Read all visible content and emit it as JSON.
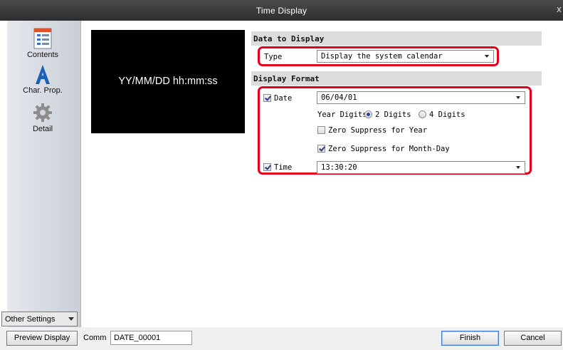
{
  "window": {
    "title": "Time Display",
    "close_glyph": "x"
  },
  "sidebar": {
    "items": [
      {
        "label": "Contents",
        "icon": "contents-icon"
      },
      {
        "label": "Char. Prop.",
        "icon": "char-prop-icon"
      },
      {
        "label": "Detail",
        "icon": "gear-icon"
      }
    ],
    "other_settings": "Other Settings"
  },
  "preview": {
    "text": "YY/MM/DD hh:mm:ss"
  },
  "data_to_display": {
    "header": "Data to Display",
    "type_label": "Type",
    "type_value": "Display the system calendar"
  },
  "display_format": {
    "header": "Display Format",
    "date_label": "Date",
    "date_checked": true,
    "date_value": "06/04/01",
    "year_digits_label": "Year Digits",
    "year_2_label": "2 Digits",
    "year_4_label": "4 Digits",
    "year_digits_selected": "2 Digits",
    "zero_suppress_year_label": "Zero Suppress for Year",
    "zero_suppress_year_checked": false,
    "zero_suppress_md_label": "Zero Suppress for Month-Day",
    "zero_suppress_md_checked": true,
    "time_label": "Time",
    "time_checked": true,
    "time_value": "13:30:20"
  },
  "bottom": {
    "preview_button": "Preview Display",
    "comm_label": "Comm",
    "comm_value": "DATE_00001",
    "finish_button": "Finish",
    "cancel_button": "Cancel"
  },
  "colors": {
    "highlight": "#e4001b",
    "titlebar": "#3a3a3a",
    "preview_bg": "#000000"
  }
}
